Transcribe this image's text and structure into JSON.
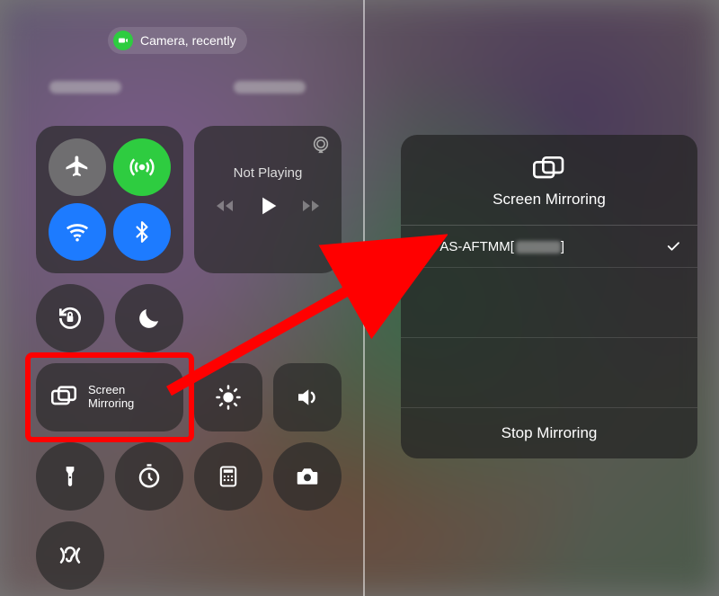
{
  "status": {
    "text": "Camera, recently"
  },
  "media": {
    "not_playing": "Not Playing"
  },
  "screen_mirroring_tile": {
    "line1": "Screen",
    "line2": "Mirroring"
  },
  "popup": {
    "title": "Screen Mirroring",
    "device_badge": "tv",
    "device_name": "AS-AFTMM[",
    "device_name_suffix": "]",
    "stop": "Stop Mirroring"
  }
}
